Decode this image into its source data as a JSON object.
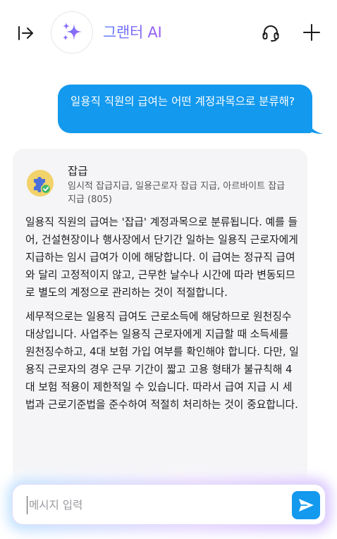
{
  "header": {
    "app_title": "그랜터 AI",
    "collapse_icon": "sidebar-collapse-icon",
    "avatar_icon": "sparkles-icon",
    "support_icon": "headset-icon",
    "new_chat_icon": "plus-icon"
  },
  "conversation": {
    "user_message": "일용직 직원의 급여는 어떤 계정과목으로 분류해?",
    "assistant": {
      "account": {
        "title": "잡급",
        "subtitle": "임시적 잡급지급, 일용근로자 잡급 지급, 아르바이트 잡급 지급 (805)",
        "icon": "puzzle-check-icon"
      },
      "paragraphs": [
        "일용직 직원의 급여는 '잡급' 계정과목으로 분류됩니다. 예를 들어, 건설현장이나 행사장에서 단기간 일하는 일용직 근로자에게 지급하는 임시 급여가 이에 해당합니다. 이 급여는 정규직 급여와 달리 고정적이지 않고, 근무한 날수나 시간에 따라 변동되므로 별도의 계정으로 관리하는 것이 적절합니다.",
        "세무적으로는 일용직 급여도 근로소득에 해당하므로 원천징수 대상입니다. 사업주는 일용직 근로자에게 지급할 때 소득세를 원천징수하고, 4대 보험 가입 여부를 확인해야 합니다. 다만, 일용직 근로자의 경우 근무 기간이 짧고 고용 형태가 불규칙해 4대 보험 적용이 제한적일 수 있습니다. 따라서 급여 지급 시 세법과 근로기준법을 준수하여 적절히 처리하는 것이 중요합니다."
      ]
    }
  },
  "composer": {
    "placeholder": "메시지 입력",
    "value": "",
    "send_icon": "send-icon"
  },
  "colors": {
    "accent": "#1399ee",
    "title_gradient_start": "#5b7cff",
    "title_gradient_end": "#9a5cf0",
    "card_bg": "#f5f5f7"
  }
}
